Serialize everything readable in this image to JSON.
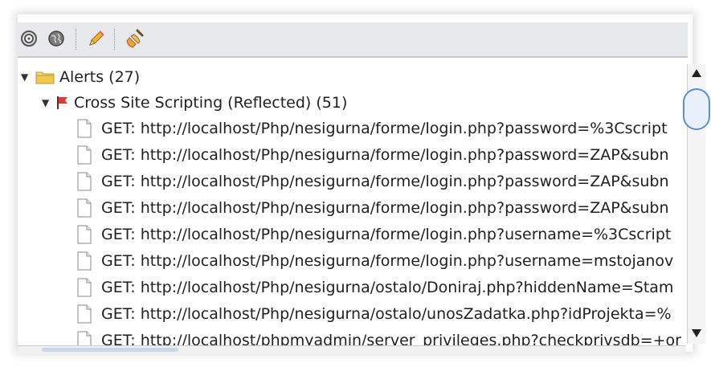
{
  "tree": {
    "root": {
      "label": "Alerts (27)",
      "expanded": true
    },
    "group": {
      "label": "Cross Site Scripting (Reflected) (51)",
      "expanded": true
    },
    "items": [
      {
        "text": "GET: http://localhost/Php/nesigurna/forme/login.php?password=%3Cscript"
      },
      {
        "text": "GET: http://localhost/Php/nesigurna/forme/login.php?password=ZAP&subn"
      },
      {
        "text": "GET: http://localhost/Php/nesigurna/forme/login.php?password=ZAP&subn"
      },
      {
        "text": "GET: http://localhost/Php/nesigurna/forme/login.php?password=ZAP&subn"
      },
      {
        "text": "GET: http://localhost/Php/nesigurna/forme/login.php?username=%3Cscript"
      },
      {
        "text": "GET: http://localhost/Php/nesigurna/forme/login.php?username=mstojanov"
      },
      {
        "text": "GET: http://localhost/Php/nesigurna/ostalo/Doniraj.php?hiddenName=Stam"
      },
      {
        "text": "GET: http://localhost/Php/nesigurna/ostalo/unosZadatka.php?idProjekta=%"
      },
      {
        "text": "GET: http://localhost/phpmyadmin/server_privileges.php?checkprivsdb=+or"
      }
    ]
  },
  "toolbar": {
    "icons": [
      "target-icon",
      "globe-icon",
      "pencil-icon",
      "broom-icon"
    ]
  },
  "colors": {
    "toolbar_bg": "#e8e9ec",
    "folder": "#f2c94c",
    "flag": "#e23b2e",
    "scroll_thumb": "#5b8fd1"
  }
}
